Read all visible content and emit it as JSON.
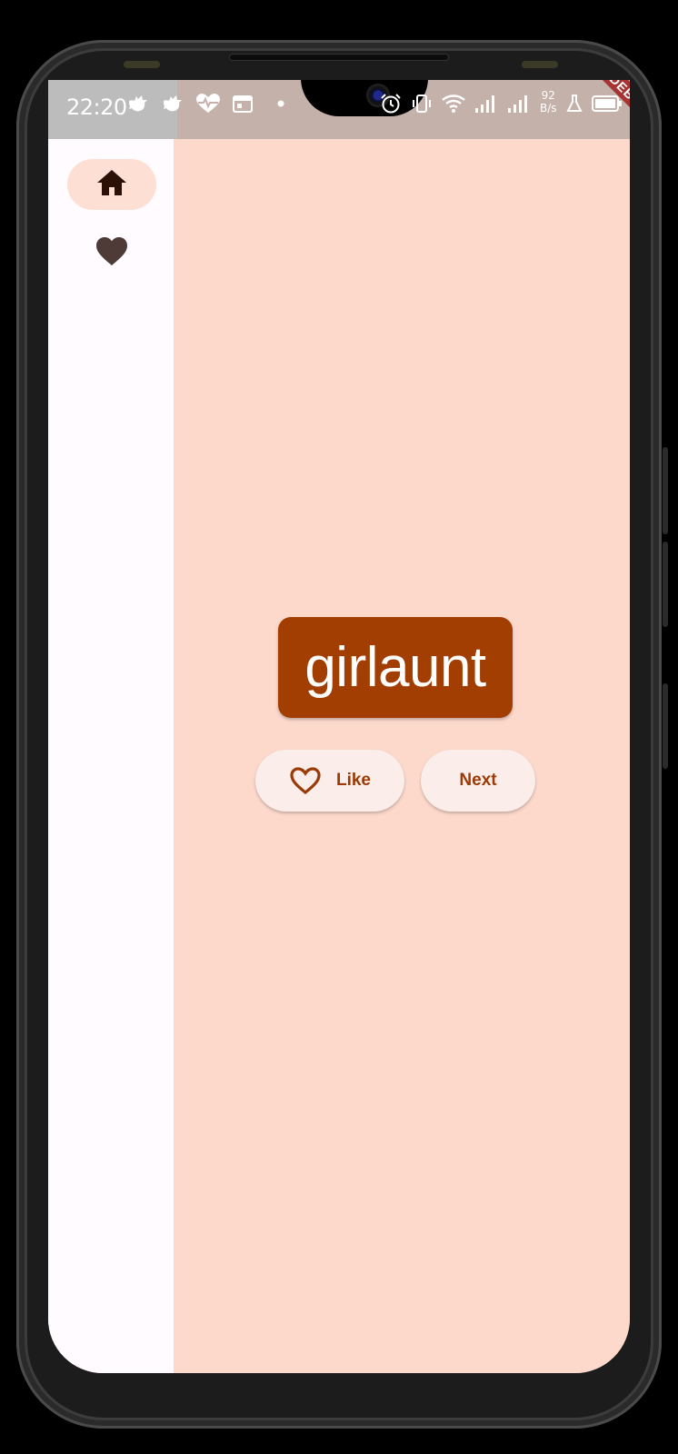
{
  "status_bar": {
    "time": "22:20",
    "left_icons": [
      "notification-bird-icon",
      "notification-bird-icon",
      "heart-pulse-icon",
      "calendar-icon",
      "dot-icon"
    ],
    "right_icons": [
      "alarm-icon",
      "vibrate-icon",
      "wifi-icon",
      "signal-icon",
      "signal-icon"
    ],
    "net_speed_value": "92",
    "net_speed_unit": "B/s",
    "battery_icon": "battery-icon",
    "beaker_icon": "beaker-icon"
  },
  "debug_banner": {
    "label": "DEBUG"
  },
  "navigation_rail": {
    "items": [
      {
        "icon": "home-icon",
        "selected": true
      },
      {
        "icon": "heart-filled-icon",
        "selected": false
      }
    ]
  },
  "main": {
    "word_pair": "girlaunt",
    "like_button_label": "Like",
    "like_button_icon": "heart-outline-icon",
    "next_button_label": "Next"
  },
  "colors": {
    "background": "#fdd9cc",
    "rail_background": "#fffbfe",
    "rail_selected_indicator": "#fedfd4",
    "card": "#a33e02",
    "button_background": "#fbeeea",
    "button_text": "#9a3a06",
    "debug_ribbon": "#a83333"
  }
}
